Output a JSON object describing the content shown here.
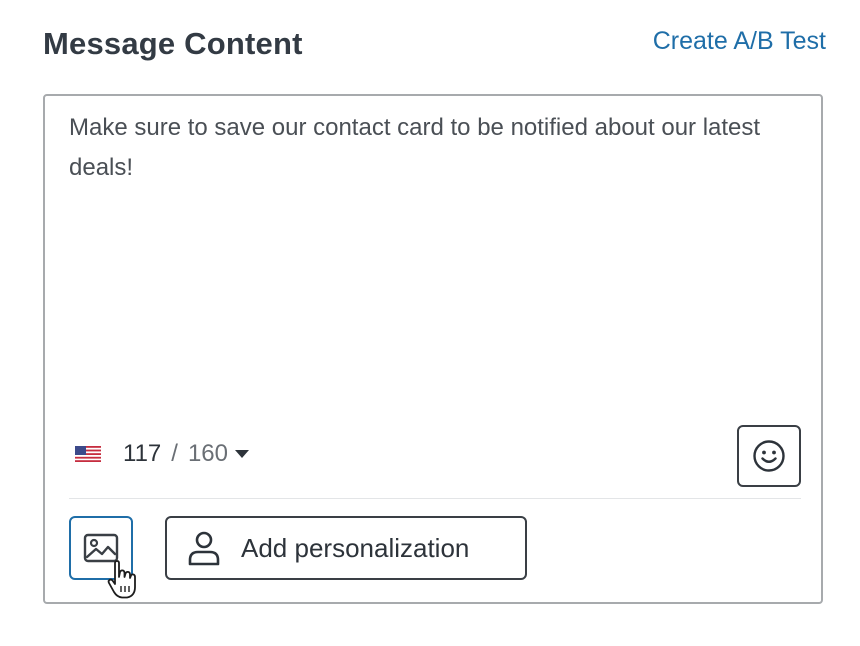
{
  "header": {
    "title": "Message Content",
    "ab_test_link": "Create A/B Test"
  },
  "editor": {
    "message": "Make sure to save our contact card to be notified about our latest deals!",
    "counter": {
      "current": "117",
      "separator": "/",
      "max": "160",
      "flag_icon": "us-flag-icon"
    },
    "emoji_button_icon": "smiley-icon",
    "image_button_icon": "image-icon",
    "personalization_label": "Add personalization",
    "personalization_icon": "person-icon"
  },
  "colors": {
    "link": "#1f6ea8",
    "title": "#333b44",
    "border": "#a7aaad",
    "button_border": "#3a3f45",
    "image_button_border": "#1f6ea8"
  }
}
